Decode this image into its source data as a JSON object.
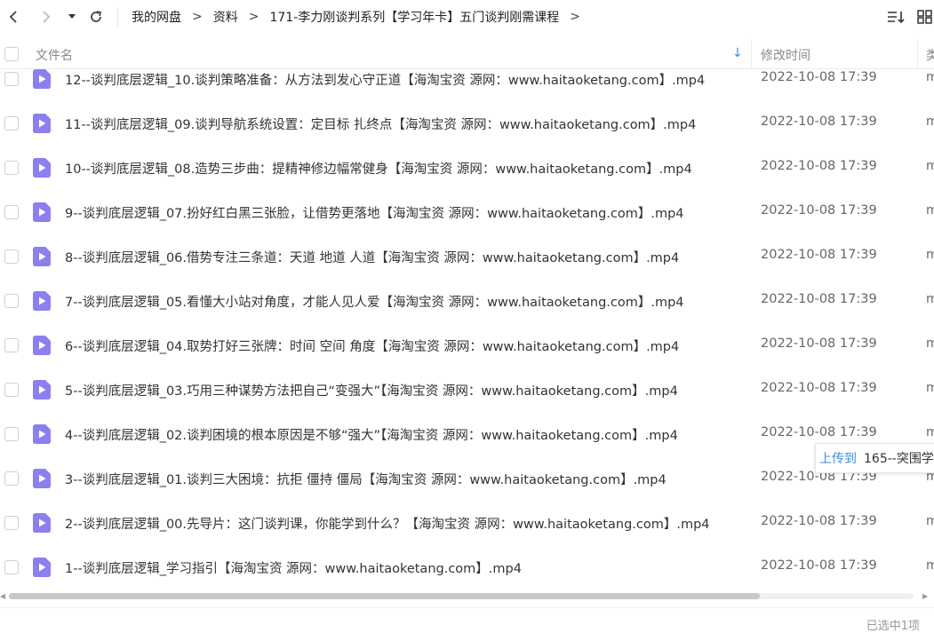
{
  "toolbar": {
    "breadcrumb": [
      "我的网盘",
      "资料",
      "171-李力刚谈判系列【学习年卡】五门谈判刚需课程"
    ],
    "separator": ">"
  },
  "header": {
    "name_label": "文件名",
    "time_label": "修改时间",
    "type_label": "类",
    "sort_indicator": "↓"
  },
  "files": [
    {
      "name": "12--谈判底层逻辑_10.谈判策略准备：从方法到发心守正道【海淘宝资 源网：www.haitaoketang.com】.mp4",
      "time": "2022-10-08 17:39",
      "type": "m"
    },
    {
      "name": "11--谈判底层逻辑_09.谈判导航系统设置：定目标 扎终点【海淘宝资 源网：www.haitaoketang.com】.mp4",
      "time": "2022-10-08 17:39",
      "type": "m"
    },
    {
      "name": "10--谈判底层逻辑_08.造势三步曲：提精神修边幅常健身【海淘宝资 源网：www.haitaoketang.com】.mp4",
      "time": "2022-10-08 17:39",
      "type": "m"
    },
    {
      "name": "9--谈判底层逻辑_07.扮好红白黑三张脸，让借势更落地【海淘宝资 源网：www.haitaoketang.com】.mp4",
      "time": "2022-10-08 17:39",
      "type": "m"
    },
    {
      "name": "8--谈判底层逻辑_06.借势专注三条道：天道 地道 人道【海淘宝资 源网：www.haitaoketang.com】.mp4",
      "time": "2022-10-08 17:39",
      "type": "m"
    },
    {
      "name": "7--谈判底层逻辑_05.看懂大小站对角度，才能人见人爱【海淘宝资 源网：www.haitaoketang.com】.mp4",
      "time": "2022-10-08 17:39",
      "type": "m"
    },
    {
      "name": "6--谈判底层逻辑_04.取势打好三张牌：时间 空间 角度【海淘宝资 源网：www.haitaoketang.com】.mp4",
      "time": "2022-10-08 17:39",
      "type": "m"
    },
    {
      "name": "5--谈判底层逻辑_03.巧用三种谋势方法把自己“变强大”【海淘宝资 源网：www.haitaoketang.com】.mp4",
      "time": "2022-10-08 17:39",
      "type": "m"
    },
    {
      "name": "4--谈判底层逻辑_02.谈判困境的根本原因是不够“强大”【海淘宝资 源网：www.haitaoketang.com】.mp4",
      "time": "2022-10-08 17:39",
      "type": "m"
    },
    {
      "name": "3--谈判底层逻辑_01.谈判三大困境：抗拒 僵持 僵局【海淘宝资 源网：www.haitaoketang.com】.mp4",
      "time": "2022-10-08 17:39",
      "type": "m"
    },
    {
      "name": "2--谈判底层逻辑_00.先导片：这门谈判课，你能学到什么？【海淘宝资 源网：www.haitaoketang.com】.mp4",
      "time": "2022-10-08 17:39",
      "type": "m"
    },
    {
      "name": "1--谈判底层逻辑_学习指引【海淘宝资 源网：www.haitaoketang.com】.mp4",
      "time": "2022-10-08 17:39",
      "type": "m"
    }
  ],
  "tooltip": {
    "label": "上传到",
    "value": "165--突围学"
  },
  "scroll": {
    "fraction": 0.83
  },
  "status": {
    "text": "已选中1项"
  },
  "colors": {
    "accent": "#3a8ee6",
    "video_icon": "#8c7ff0"
  }
}
